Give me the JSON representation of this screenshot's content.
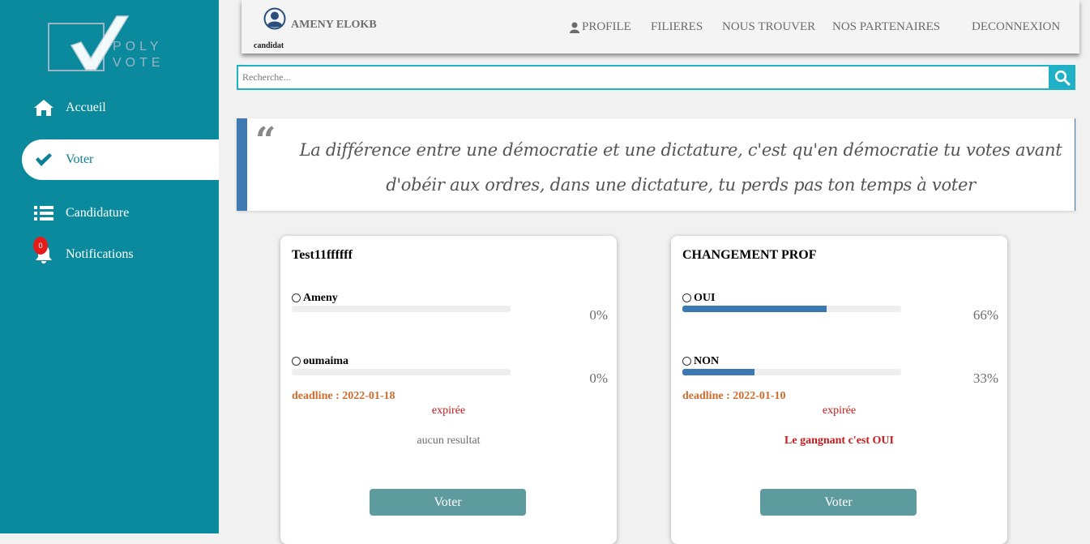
{
  "logo": {
    "word1": "POLY",
    "word2": "VOTE"
  },
  "sidebar": {
    "items": [
      {
        "label": "Accueil",
        "icon": "home-icon"
      },
      {
        "label": "Voter",
        "icon": "check-icon",
        "active": true
      },
      {
        "label": "Candidature",
        "icon": "list-icon"
      },
      {
        "label": "Notifications",
        "icon": "bell-icon",
        "badge": "0"
      }
    ]
  },
  "header": {
    "user_name": "AMENY ELOKB",
    "user_role": "candidat",
    "nav": {
      "profile": "PROFILE",
      "filieres": "FILIERES",
      "nous_trouver": "NOUS TROUVER",
      "partenaires": "NOS PARTENAIRES",
      "deconnexion": "DECONNEXION"
    }
  },
  "search": {
    "placeholder": "Recherche..."
  },
  "quote": {
    "mark": "“",
    "text": "La différence entre une démocratie et une dictature, c'est qu'en démocratie tu votes avant d'obéir aux ordres, dans une dictature, tu perds pas ton temps à voter"
  },
  "polls": [
    {
      "title": "Test11ffffff",
      "options": [
        {
          "label": "Ameny",
          "percent": 0,
          "percent_label": "0%"
        },
        {
          "label": "oumaima",
          "percent": 0,
          "percent_label": "0%"
        }
      ],
      "deadline": "deadline : 2022-01-18",
      "status": "expirée",
      "result": "aucun resultat",
      "vote_label": "Voter"
    },
    {
      "title": "CHANGEMENT PROF",
      "options": [
        {
          "label": "OUI",
          "percent": 66,
          "percent_label": "66%"
        },
        {
          "label": "NON",
          "percent": 33,
          "percent_label": "33%"
        }
      ],
      "deadline": "deadline : 2022-01-10",
      "status": "expirée",
      "result": "Le gangnant c'est OUI",
      "vote_label": "Voter"
    }
  ],
  "colors": {
    "sidebar": "#0b8a9d",
    "accent": "#20b1c7",
    "progress": "#3c78b4",
    "deadline": "#cf6b2c",
    "expired": "#c81818",
    "vote_button": "#5e9b9f"
  }
}
